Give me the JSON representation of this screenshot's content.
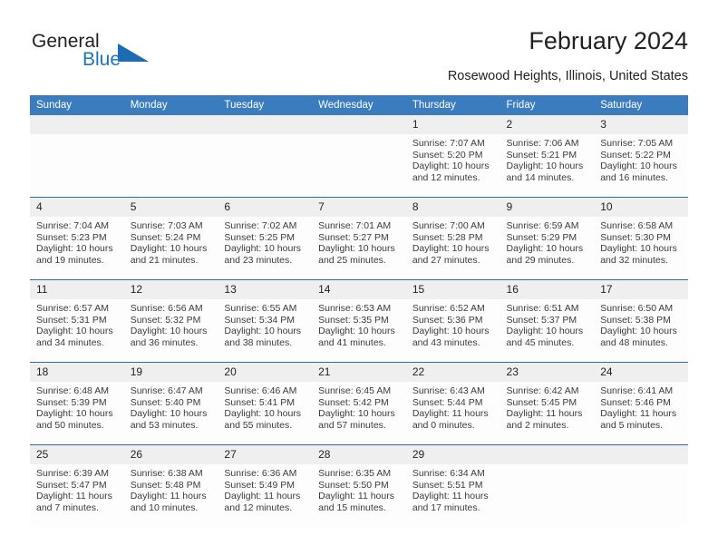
{
  "brand": {
    "name_part1": "General",
    "name_part2": "Blue",
    "logo_icon": "blue-triangle-icon"
  },
  "header": {
    "title": "February 2024",
    "location": "Rosewood Heights, Illinois, United States"
  },
  "theme": {
    "header_blue": "#3a7cbe",
    "rule_blue": "#2e6da4",
    "daynum_gray": "#efefef",
    "brand_blue": "#1b75bb"
  },
  "weekdays": [
    "Sunday",
    "Monday",
    "Tuesday",
    "Wednesday",
    "Thursday",
    "Friday",
    "Saturday"
  ],
  "labels": {
    "sunrise_prefix": "Sunrise:",
    "sunset_prefix": "Sunset:",
    "daylight_prefix": "Daylight:"
  },
  "weeks": [
    [
      {
        "day": "",
        "empty": true
      },
      {
        "day": "",
        "empty": true
      },
      {
        "day": "",
        "empty": true
      },
      {
        "day": "",
        "empty": true
      },
      {
        "day": "1",
        "sunrise": "Sunrise: 7:07 AM",
        "sunset": "Sunset: 5:20 PM",
        "daylight1": "Daylight: 10 hours",
        "daylight2": "and 12 minutes."
      },
      {
        "day": "2",
        "sunrise": "Sunrise: 7:06 AM",
        "sunset": "Sunset: 5:21 PM",
        "daylight1": "Daylight: 10 hours",
        "daylight2": "and 14 minutes."
      },
      {
        "day": "3",
        "sunrise": "Sunrise: 7:05 AM",
        "sunset": "Sunset: 5:22 PM",
        "daylight1": "Daylight: 10 hours",
        "daylight2": "and 16 minutes."
      }
    ],
    [
      {
        "day": "4",
        "sunrise": "Sunrise: 7:04 AM",
        "sunset": "Sunset: 5:23 PM",
        "daylight1": "Daylight: 10 hours",
        "daylight2": "and 19 minutes."
      },
      {
        "day": "5",
        "sunrise": "Sunrise: 7:03 AM",
        "sunset": "Sunset: 5:24 PM",
        "daylight1": "Daylight: 10 hours",
        "daylight2": "and 21 minutes."
      },
      {
        "day": "6",
        "sunrise": "Sunrise: 7:02 AM",
        "sunset": "Sunset: 5:25 PM",
        "daylight1": "Daylight: 10 hours",
        "daylight2": "and 23 minutes."
      },
      {
        "day": "7",
        "sunrise": "Sunrise: 7:01 AM",
        "sunset": "Sunset: 5:27 PM",
        "daylight1": "Daylight: 10 hours",
        "daylight2": "and 25 minutes."
      },
      {
        "day": "8",
        "sunrise": "Sunrise: 7:00 AM",
        "sunset": "Sunset: 5:28 PM",
        "daylight1": "Daylight: 10 hours",
        "daylight2": "and 27 minutes."
      },
      {
        "day": "9",
        "sunrise": "Sunrise: 6:59 AM",
        "sunset": "Sunset: 5:29 PM",
        "daylight1": "Daylight: 10 hours",
        "daylight2": "and 29 minutes."
      },
      {
        "day": "10",
        "sunrise": "Sunrise: 6:58 AM",
        "sunset": "Sunset: 5:30 PM",
        "daylight1": "Daylight: 10 hours",
        "daylight2": "and 32 minutes."
      }
    ],
    [
      {
        "day": "11",
        "sunrise": "Sunrise: 6:57 AM",
        "sunset": "Sunset: 5:31 PM",
        "daylight1": "Daylight: 10 hours",
        "daylight2": "and 34 minutes."
      },
      {
        "day": "12",
        "sunrise": "Sunrise: 6:56 AM",
        "sunset": "Sunset: 5:32 PM",
        "daylight1": "Daylight: 10 hours",
        "daylight2": "and 36 minutes."
      },
      {
        "day": "13",
        "sunrise": "Sunrise: 6:55 AM",
        "sunset": "Sunset: 5:34 PM",
        "daylight1": "Daylight: 10 hours",
        "daylight2": "and 38 minutes."
      },
      {
        "day": "14",
        "sunrise": "Sunrise: 6:53 AM",
        "sunset": "Sunset: 5:35 PM",
        "daylight1": "Daylight: 10 hours",
        "daylight2": "and 41 minutes."
      },
      {
        "day": "15",
        "sunrise": "Sunrise: 6:52 AM",
        "sunset": "Sunset: 5:36 PM",
        "daylight1": "Daylight: 10 hours",
        "daylight2": "and 43 minutes."
      },
      {
        "day": "16",
        "sunrise": "Sunrise: 6:51 AM",
        "sunset": "Sunset: 5:37 PM",
        "daylight1": "Daylight: 10 hours",
        "daylight2": "and 45 minutes."
      },
      {
        "day": "17",
        "sunrise": "Sunrise: 6:50 AM",
        "sunset": "Sunset: 5:38 PM",
        "daylight1": "Daylight: 10 hours",
        "daylight2": "and 48 minutes."
      }
    ],
    [
      {
        "day": "18",
        "sunrise": "Sunrise: 6:48 AM",
        "sunset": "Sunset: 5:39 PM",
        "daylight1": "Daylight: 10 hours",
        "daylight2": "and 50 minutes."
      },
      {
        "day": "19",
        "sunrise": "Sunrise: 6:47 AM",
        "sunset": "Sunset: 5:40 PM",
        "daylight1": "Daylight: 10 hours",
        "daylight2": "and 53 minutes."
      },
      {
        "day": "20",
        "sunrise": "Sunrise: 6:46 AM",
        "sunset": "Sunset: 5:41 PM",
        "daylight1": "Daylight: 10 hours",
        "daylight2": "and 55 minutes."
      },
      {
        "day": "21",
        "sunrise": "Sunrise: 6:45 AM",
        "sunset": "Sunset: 5:42 PM",
        "daylight1": "Daylight: 10 hours",
        "daylight2": "and 57 minutes."
      },
      {
        "day": "22",
        "sunrise": "Sunrise: 6:43 AM",
        "sunset": "Sunset: 5:44 PM",
        "daylight1": "Daylight: 11 hours",
        "daylight2": "and 0 minutes."
      },
      {
        "day": "23",
        "sunrise": "Sunrise: 6:42 AM",
        "sunset": "Sunset: 5:45 PM",
        "daylight1": "Daylight: 11 hours",
        "daylight2": "and 2 minutes."
      },
      {
        "day": "24",
        "sunrise": "Sunrise: 6:41 AM",
        "sunset": "Sunset: 5:46 PM",
        "daylight1": "Daylight: 11 hours",
        "daylight2": "and 5 minutes."
      }
    ],
    [
      {
        "day": "25",
        "sunrise": "Sunrise: 6:39 AM",
        "sunset": "Sunset: 5:47 PM",
        "daylight1": "Daylight: 11 hours",
        "daylight2": "and 7 minutes."
      },
      {
        "day": "26",
        "sunrise": "Sunrise: 6:38 AM",
        "sunset": "Sunset: 5:48 PM",
        "daylight1": "Daylight: 11 hours",
        "daylight2": "and 10 minutes."
      },
      {
        "day": "27",
        "sunrise": "Sunrise: 6:36 AM",
        "sunset": "Sunset: 5:49 PM",
        "daylight1": "Daylight: 11 hours",
        "daylight2": "and 12 minutes."
      },
      {
        "day": "28",
        "sunrise": "Sunrise: 6:35 AM",
        "sunset": "Sunset: 5:50 PM",
        "daylight1": "Daylight: 11 hours",
        "daylight2": "and 15 minutes."
      },
      {
        "day": "29",
        "sunrise": "Sunrise: 6:34 AM",
        "sunset": "Sunset: 5:51 PM",
        "daylight1": "Daylight: 11 hours",
        "daylight2": "and 17 minutes."
      },
      {
        "day": "",
        "empty": true
      },
      {
        "day": "",
        "empty": true
      }
    ]
  ]
}
